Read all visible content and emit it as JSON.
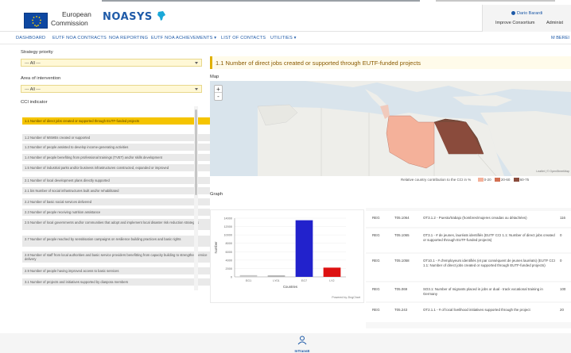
{
  "header": {
    "eu_line1": "European",
    "eu_line2": "Commission",
    "app_name": "NOASYS",
    "user_name": "Dario Barardi",
    "improve_label": "Improve Consortium",
    "admin_label": "Administ"
  },
  "nav": {
    "items": [
      "DASHBOARD",
      "EUTF NOA CONTRACTS",
      "NOA REPORTING",
      "EUTF NOA ACHIEVEMENTS ▾",
      "LIST OF CONTACTS",
      "UTILITIES ▾"
    ],
    "right": "M BEREI"
  },
  "filters": {
    "strategy_label": "Strategy priority",
    "strategy_value": "--- All ---",
    "intervention_label": "Area of intervention",
    "intervention_value": "--- All ---",
    "cci_label": "CCI indicator"
  },
  "cci_items": [
    "1.1 Number of direct jobs created or supported through EUTF-funded projects",
    "1.2 Number of MSMEs created or supported",
    "1.3 Number of people assisted to develop income-generating activities",
    "1.4 Number of people benefiting from professional trainings (TVET) and/or skills development",
    "1.5 Number of industrial parks and/or business infrastructures constructed, expanded or improved",
    "2.1 Number of local development plans directly supported",
    "2.1 bis Number of social infrastructures built and/or rehabilitated",
    "2.2 Number of basic social services delivered",
    "2.3 Number of people receiving nutrition assistance",
    "2.5 Number of local governments and/or communities that adopt and implement local disaster risk reduction strategies",
    "2.7 Number of people reached by sensitisation campaigns on resilience building practices and basic rights",
    "2.8 Number of staff from local authorities and basic service providers benefitting from capacity building to strengthen service delivery",
    "2.9 Number of people having improved access to basic services",
    "3.1 Number of projects and initiatives supported by diaspora members"
  ],
  "main": {
    "title": "1.1 Number of direct jobs created or supported through EUTF-funded projects",
    "map_label": "Map",
    "zoom_in": "+",
    "zoom_out": "-",
    "map_attr": "Leaflet | © OpenStreetMap",
    "legend_title": "Relative country contribution to the CCI in %",
    "legend": [
      {
        "label": "0-20",
        "color": "#f4b19a"
      },
      {
        "label": "20-60",
        "color": "#d26f52"
      },
      {
        "label": "60-75",
        "color": "#8a4b3c"
      }
    ],
    "graph_label": "Graph",
    "powered_by": "Powered by ZingChart"
  },
  "chart_data": {
    "type": "bar",
    "categories": [
      "EG1",
      "LY01",
      "EG7",
      "LY2"
    ],
    "values": [
      400,
      350,
      13500,
      2200
    ],
    "colors": [
      "#c8c8c8",
      "#b0b0b0",
      "#2222cc",
      "#dd1111"
    ],
    "xlabel": "Countries",
    "ylabel": "Number",
    "yticks": [
      0,
      2000,
      4000,
      6000,
      8000,
      10000,
      12000,
      14000
    ],
    "ylim": [
      0,
      14000
    ]
  },
  "table": {
    "rows": [
      {
        "c1": "REG",
        "c2": "T05.1064",
        "c3": "OT3.1.2 - Puesto/trabajo (hombres/mujeres creadas ou détachées)",
        "c4": "116"
      },
      {
        "c1": "REG",
        "c2": "T05.1065",
        "c3": "OT3.1 - # de jeunes, lauréats identifiés (EUTF CCI 1.1: Number of direct jobs created or supported through EUTF-funded projects)",
        "c4": "0"
      },
      {
        "c1": "REG",
        "c2": "T05.1058",
        "c3": "OT10.1 - # d'employeurs identifiés (et par conséquent de jeunes lauréats) (EUTF CCI 1.1: Number of direct jobs created or supported through EUTF-funded projects)",
        "c4": "0"
      },
      {
        "c1": "REG",
        "c2": "T05.069",
        "c3": "SO3.1: Number of migrants placed in jobs or dual - track vocational training in Germany",
        "c4": "100"
      },
      {
        "c1": "REG",
        "c2": "T05.243",
        "c3": "OT2.1.1 - # of local livelihood initiatives supported through the project",
        "c4": "20"
      }
    ]
  },
  "footer": {
    "logo_text": "InTransE"
  }
}
